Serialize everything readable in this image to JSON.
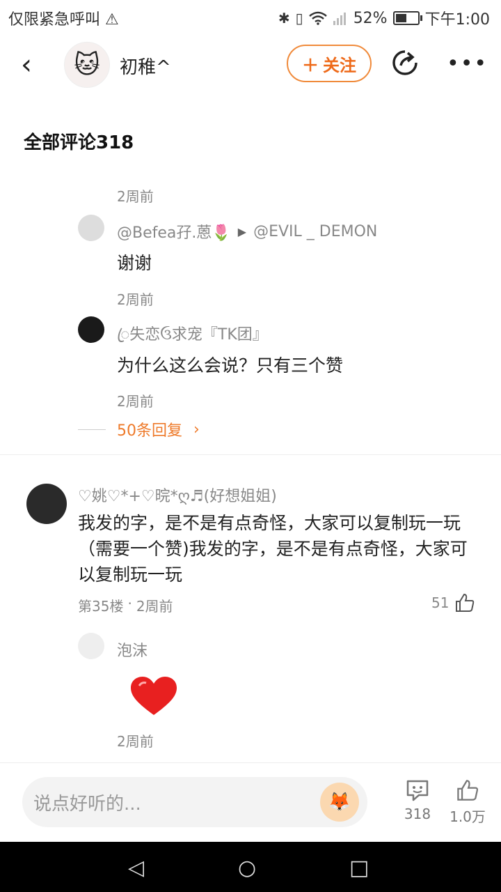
{
  "status_bar": {
    "carrier": "仅限紧急呼叫",
    "battery": "52%",
    "battery_level": 0.52,
    "time": "下午1:00"
  },
  "header": {
    "username": "初稚^",
    "follow_label": "关注"
  },
  "comments_title": "全部评论318",
  "replies": [
    {
      "time": "2周前",
      "name": "@Befea孖.蒽🌷",
      "target": "@EVIL _ DEMON",
      "text": "谢谢"
    },
    {
      "time": "2周前",
      "name": "ꦿ失恋ઉ求宠『TK团』",
      "target": "",
      "text": "为什么这么会说？只有三个赞"
    },
    {
      "time": "2周前"
    }
  ],
  "more_replies": "50条回复",
  "comment": {
    "name": "♡姚♡*+♡晥*ღ♬(好想姐姐)",
    "text": "我发的字，是不是有点奇怪，大家可以复制玩一玩（需要一个赞)我发的字，是不是有点奇怪，大家可以复制玩一玩",
    "floor": "第35楼",
    "time": "2周前",
    "likes": "51"
  },
  "sub_reply": {
    "name": "泡沫",
    "time": "2周前"
  },
  "bottom_bar": {
    "placeholder": "说点好听的...",
    "comments_count": "318",
    "likes_count": "1.0万"
  },
  "icons": [
    "back-icon",
    "share-icon",
    "more-icon",
    "play-arrow-icon",
    "chevron-right-icon",
    "thumb-up-icon",
    "comment-icon",
    "heart-icon",
    "wifi-icon",
    "bluetooth-icon",
    "vibrate-icon",
    "warning-icon",
    "battery-icon"
  ],
  "colors": {
    "accent": "#ee6a1a"
  }
}
